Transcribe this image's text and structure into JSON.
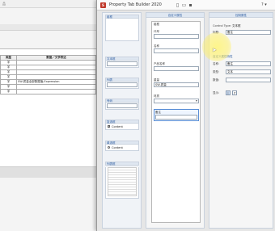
{
  "background": {
    "top_label": "品",
    "table": {
      "header": [
        "类型",
        "数据／文字表达"
      ],
      "rows": [
        [
          "字",
          ""
        ],
        [
          "字",
          ""
        ],
        [
          "字",
          ""
        ],
        [
          "字",
          ""
        ],
        [
          "字",
          "SW-质量全部数据值;Expression"
        ],
        [
          "字",
          ""
        ],
        [
          "字",
          ""
        ]
      ]
    }
  },
  "window": {
    "app_icon": "sw-logo-icon",
    "title": "Property Tab Builder 2020",
    "help": "? ▾"
  },
  "left_panel": {
    "groups": [
      {
        "title": "组框",
        "kind": "box"
      },
      {
        "title": "文本框",
        "kind": "input"
      },
      {
        "title": "列表",
        "kind": "input"
      },
      {
        "title": "号码",
        "kind": "input"
      },
      {
        "title": "复选框",
        "kind": "checkbox",
        "item": "Content"
      },
      {
        "title": "单选框",
        "kind": "radio",
        "item": "Content"
      },
      {
        "title": "列表框",
        "kind": "list"
      }
    ]
  },
  "center_panel": {
    "header": "自定义属性",
    "fields": [
      {
        "label": "组框",
        "value": ""
      },
      {
        "label": "代号",
        "value": ""
      },
      {
        "label": "名称",
        "value": ""
      },
      {
        "label": "产品名称",
        "value": ""
      },
      {
        "label": "重量",
        "value": "SW-质量"
      },
      {
        "label": "材质",
        "value": ""
      },
      {
        "label": "备注",
        "value": "备注"
      }
    ]
  },
  "right_panel": {
    "header": "控制属性",
    "control_type_label": "Control Type:",
    "control_type_value": "文本框",
    "caption_label": "标题:",
    "caption_value": "备注",
    "section_title": "自定义属性特性",
    "name_label": "名称:",
    "name_value": "备注",
    "type_label": "类型:",
    "type_value": "文本",
    "default_label": "数值:",
    "default_value": "",
    "align_label": "显示:"
  }
}
